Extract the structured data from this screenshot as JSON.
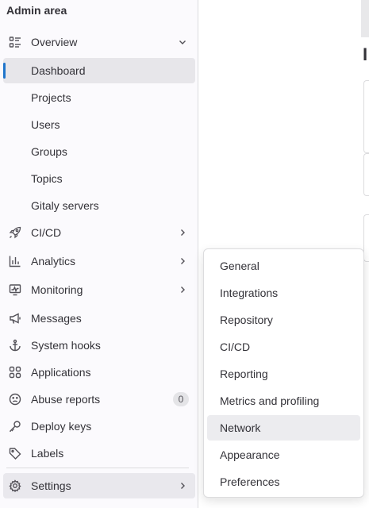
{
  "sidebar": {
    "title": "Admin area",
    "overview": {
      "label": "Overview",
      "icon": "overview-list-icon",
      "items": [
        {
          "label": "Dashboard",
          "active": true
        },
        {
          "label": "Projects"
        },
        {
          "label": "Users"
        },
        {
          "label": "Groups"
        },
        {
          "label": "Topics"
        },
        {
          "label": "Gitaly servers"
        }
      ]
    },
    "sections": [
      {
        "label": "CI/CD",
        "icon": "rocket-icon",
        "expandable": true
      },
      {
        "label": "Analytics",
        "icon": "chart-icon",
        "expandable": true
      },
      {
        "label": "Monitoring",
        "icon": "monitor-icon",
        "expandable": true
      },
      {
        "label": "Messages",
        "icon": "megaphone-icon"
      },
      {
        "label": "System hooks",
        "icon": "anchor-icon"
      },
      {
        "label": "Applications",
        "icon": "applications-grid-icon"
      },
      {
        "label": "Abuse reports",
        "icon": "sad-face-icon",
        "badge": "0"
      },
      {
        "label": "Deploy keys",
        "icon": "key-icon"
      },
      {
        "label": "Labels",
        "icon": "label-tag-icon"
      }
    ],
    "settings": {
      "label": "Settings",
      "icon": "gear-icon",
      "expandable": true
    }
  },
  "page": {
    "heading_fragment": "I"
  },
  "settings_flyout": {
    "items": [
      {
        "label": "General"
      },
      {
        "label": "Integrations"
      },
      {
        "label": "Repository"
      },
      {
        "label": "CI/CD"
      },
      {
        "label": "Reporting"
      },
      {
        "label": "Metrics and profiling"
      },
      {
        "label": "Network",
        "hovered": true
      },
      {
        "label": "Appearance"
      },
      {
        "label": "Preferences"
      }
    ]
  },
  "colors": {
    "active_indicator": "#1f75cb",
    "sidebar_bg": "#fbfafd",
    "active_bg": "#e7e6ea"
  }
}
